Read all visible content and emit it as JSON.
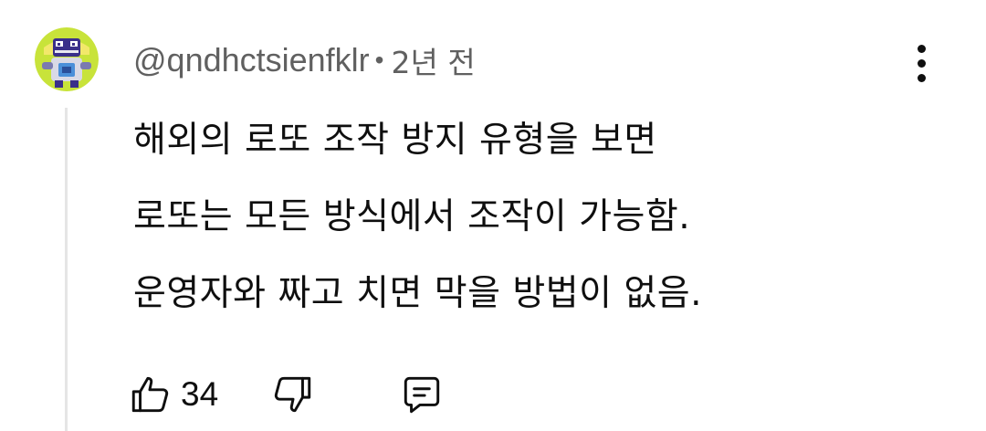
{
  "comment": {
    "author": "@qndhctsienfklr",
    "separator": "•",
    "time": "2년 전",
    "lines": [
      "해외의 로또 조작 방지 유형을 보면",
      "로또는 모든 방식에서 조작이 가능함.",
      "운영자와 짜고 치면 막을 방법이 없음."
    ],
    "like_count": "34"
  },
  "icons": {
    "avatar": "robot-avatar",
    "more": "more-vertical-icon",
    "like": "thumbs-up-icon",
    "dislike": "thumbs-down-icon",
    "reply": "reply-comment-icon"
  },
  "colors": {
    "text_primary": "#0f0f0f",
    "text_secondary": "#606060",
    "thread_line": "#e5e5e5",
    "avatar_bg": "#c8e33a"
  }
}
